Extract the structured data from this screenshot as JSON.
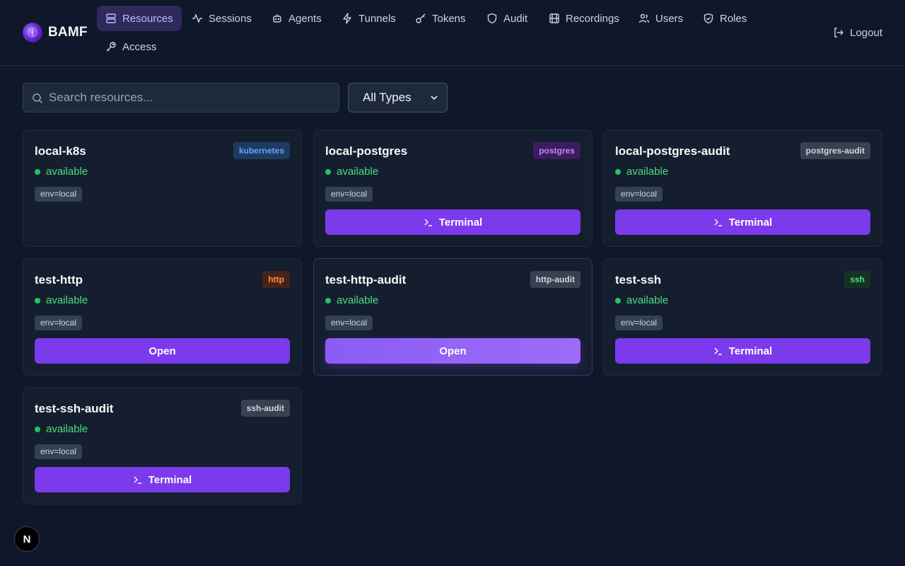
{
  "brand": {
    "name": "BAMF"
  },
  "nav": {
    "items": [
      {
        "label": "Resources",
        "icon": "server-icon",
        "active": true
      },
      {
        "label": "Sessions",
        "icon": "activity-icon",
        "active": false
      },
      {
        "label": "Agents",
        "icon": "bot-icon",
        "active": false
      },
      {
        "label": "Tunnels",
        "icon": "zap-icon",
        "active": false
      },
      {
        "label": "Tokens",
        "icon": "key-icon",
        "active": false
      },
      {
        "label": "Audit",
        "icon": "shield-icon",
        "active": false
      },
      {
        "label": "Recordings",
        "icon": "film-icon",
        "active": false
      },
      {
        "label": "Users",
        "icon": "users-icon",
        "active": false
      },
      {
        "label": "Roles",
        "icon": "shield-check-icon",
        "active": false
      },
      {
        "label": "Access",
        "icon": "key-round-icon",
        "active": false
      }
    ],
    "logout_label": "Logout"
  },
  "filters": {
    "search_placeholder": "Search resources...",
    "search_value": "",
    "type_selected": "All Types"
  },
  "colors": {
    "accent": "#7c3aed",
    "status_available": "#22c55e",
    "background": "#0f172a",
    "card": "#151e2e"
  },
  "resources": [
    {
      "name": "local-k8s",
      "type": "kubernetes",
      "badge_bg": "#1e3a5f",
      "badge_fg": "#60a5fa",
      "status": "available",
      "tag": "env=local",
      "action": null
    },
    {
      "name": "local-postgres",
      "type": "postgres",
      "badge_bg": "#3b1d5e",
      "badge_fg": "#c084fc",
      "status": "available",
      "tag": "env=local",
      "action": "Terminal"
    },
    {
      "name": "local-postgres-audit",
      "type": "postgres-audit",
      "badge_bg": "#374151",
      "badge_fg": "#d1d5db",
      "status": "available",
      "tag": "env=local",
      "action": "Terminal"
    },
    {
      "name": "test-http",
      "type": "http",
      "badge_bg": "#43231a",
      "badge_fg": "#fb923c",
      "status": "available",
      "tag": "env=local",
      "action": "Open"
    },
    {
      "name": "test-http-audit",
      "type": "http-audit",
      "badge_bg": "#374151",
      "badge_fg": "#d1d5db",
      "status": "available",
      "tag": "env=local",
      "action": "Open"
    },
    {
      "name": "test-ssh",
      "type": "ssh",
      "badge_bg": "#153324",
      "badge_fg": "#4ade80",
      "status": "available",
      "tag": "env=local",
      "action": "Terminal"
    },
    {
      "name": "test-ssh-audit",
      "type": "ssh-audit",
      "badge_bg": "#374151",
      "badge_fg": "#d1d5db",
      "status": "available",
      "tag": "env=local",
      "action": "Terminal"
    }
  ],
  "dev_indicator": {
    "label": "N"
  }
}
